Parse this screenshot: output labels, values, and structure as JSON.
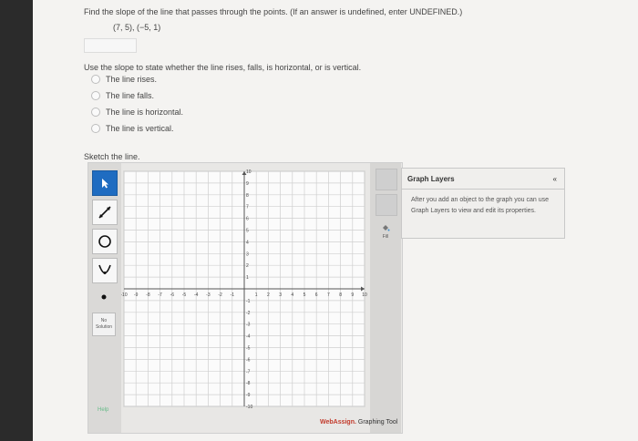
{
  "question": {
    "prompt": "Find the slope of the line that passes through the points. (If an answer is undefined, enter UNDEFINED.)",
    "points": "(7, 5), (−5, 1)"
  },
  "classify": {
    "prompt": "Use the slope to state whether the line rises, falls, is horizontal, or is vertical.",
    "options": [
      "The line rises.",
      "The line falls.",
      "The line is horizontal.",
      "The line is vertical."
    ]
  },
  "sketch": {
    "label": "Sketch the line."
  },
  "tool": {
    "no_solution": "No Solution",
    "help": "Help",
    "fill": "Fill",
    "brand_prefix": "WebAssign.",
    "brand_suffix": " Graphing Tool",
    "x_ticks": [
      "-10",
      "-9",
      "-8",
      "-7",
      "-6",
      "-5",
      "-4",
      "-3",
      "-2",
      "-1",
      "1",
      "2",
      "3",
      "4",
      "5",
      "6",
      "7",
      "8",
      "9",
      "10"
    ],
    "y_ticks": [
      "10",
      "9",
      "8",
      "7",
      "6",
      "5",
      "4",
      "3",
      "2",
      "1",
      "-1",
      "-2",
      "-3",
      "-4",
      "-5",
      "-6",
      "-7",
      "-8",
      "-9",
      "-10"
    ]
  },
  "layers": {
    "title": "Graph Layers",
    "collapse": "«",
    "body": "After you add an object to the graph you can use Graph Layers to view and edit its properties."
  }
}
